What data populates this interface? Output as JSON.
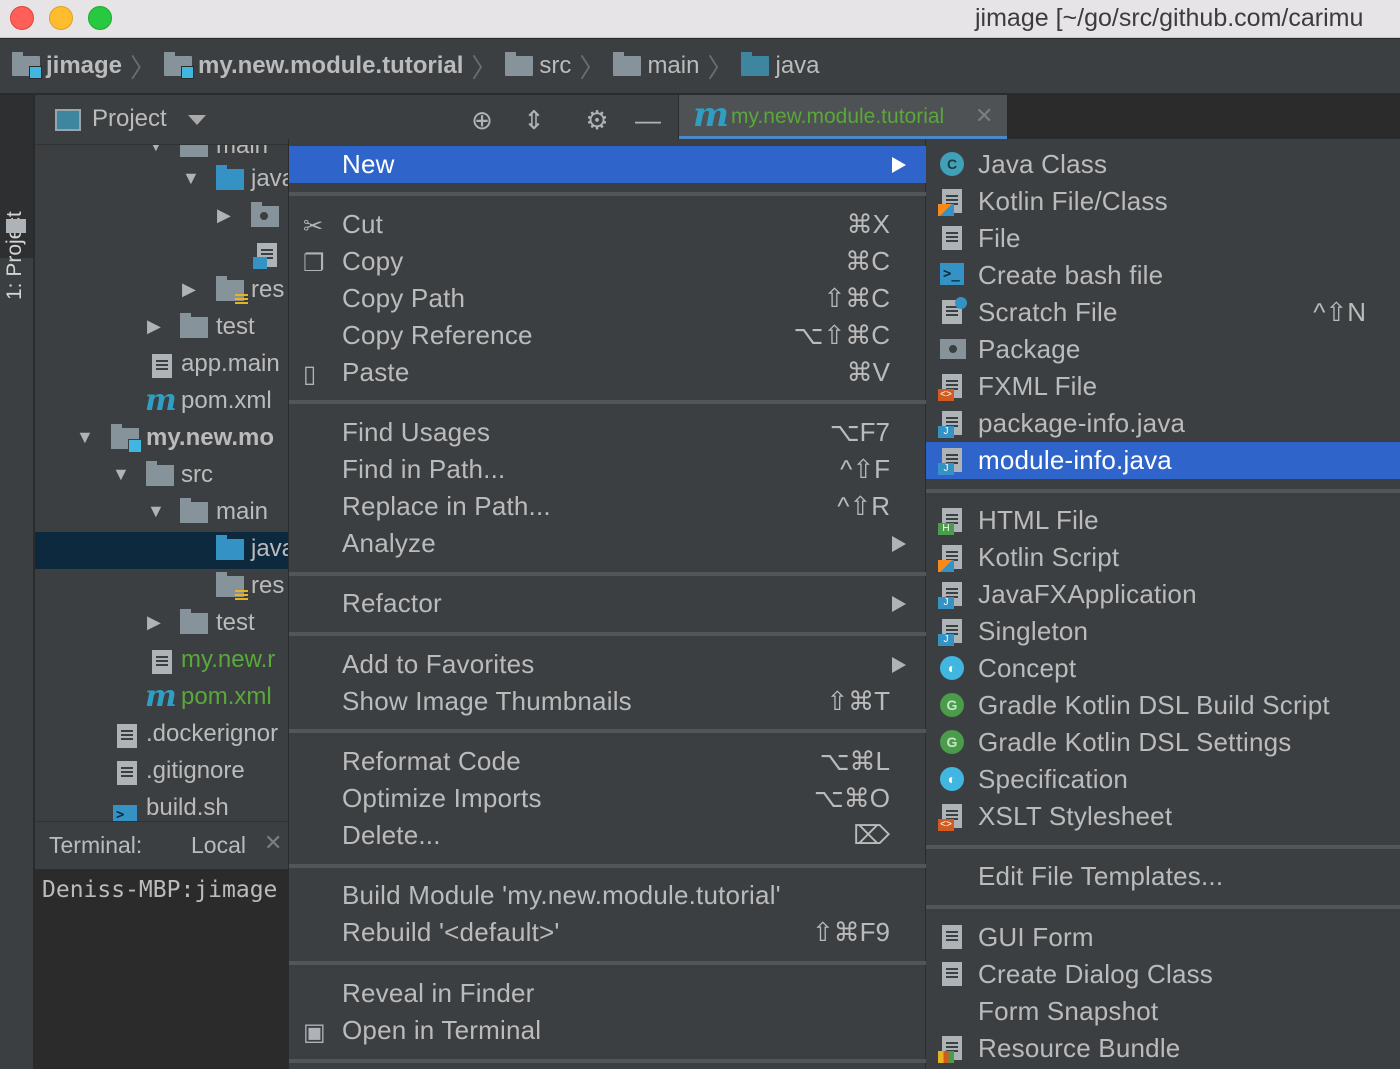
{
  "window": {
    "title": "jimage [~/go/src/github.com/carimu"
  },
  "breadcrumb": [
    "jimage",
    "my.new.module.tutorial",
    "src",
    "main",
    "java"
  ],
  "toolstrip": {
    "project_tab": "1: Project"
  },
  "project_panel": {
    "title": "Project"
  },
  "editor_tab": {
    "name": "my.new.module.tutorial"
  },
  "tree": {
    "rows": [
      {
        "label": "main"
      },
      {
        "label": "java"
      },
      {
        "label": ""
      },
      {
        "label": ""
      },
      {
        "label": "res"
      },
      {
        "label": "test"
      },
      {
        "label": "app.main"
      },
      {
        "label": "pom.xml"
      },
      {
        "label": "my.new.mo"
      },
      {
        "label": "src"
      },
      {
        "label": "main"
      },
      {
        "label": "java"
      },
      {
        "label": "res"
      },
      {
        "label": "test"
      },
      {
        "label": "my.new.r"
      },
      {
        "label": "pom.xml"
      },
      {
        "label": ".dockerignor"
      },
      {
        "label": ".gitignore"
      },
      {
        "label": "build.sh"
      }
    ]
  },
  "terminal": {
    "title": "Terminal:",
    "tab": "Local",
    "prompt": "Deniss-MBP:jimage"
  },
  "context_menu": {
    "new": "New",
    "cut": {
      "label": "Cut",
      "shortcut": "⌘X"
    },
    "copy": {
      "label": "Copy",
      "shortcut": "⌘C"
    },
    "copy_path": {
      "label": "Copy Path",
      "shortcut": "⇧⌘C"
    },
    "copy_reference": {
      "label": "Copy Reference",
      "shortcut": "⌥⇧⌘C"
    },
    "paste": {
      "label": "Paste",
      "shortcut": "⌘V"
    },
    "find_usages": {
      "label": "Find Usages",
      "shortcut": "⌥F7"
    },
    "find_in_path": {
      "label": "Find in Path...",
      "shortcut": "^⇧F"
    },
    "replace_in_path": {
      "label": "Replace in Path...",
      "shortcut": "^⇧R"
    },
    "analyze": {
      "label": "Analyze"
    },
    "refactor": {
      "label": "Refactor"
    },
    "add_to_favorites": {
      "label": "Add to Favorites"
    },
    "show_thumbnails": {
      "label": "Show Image Thumbnails",
      "shortcut": "⇧⌘T"
    },
    "reformat": {
      "label": "Reformat Code",
      "shortcut": "⌥⌘L"
    },
    "optimize": {
      "label": "Optimize Imports",
      "shortcut": "⌥⌘O"
    },
    "delete": {
      "label": "Delete...",
      "shortcut": "⌦"
    },
    "build_module": {
      "label": "Build Module 'my.new.module.tutorial'"
    },
    "rebuild": {
      "label": "Rebuild '<default>'",
      "shortcut": "⇧⌘F9"
    },
    "reveal": {
      "label": "Reveal in Finder"
    },
    "open_terminal": {
      "label": "Open in Terminal"
    }
  },
  "new_submenu": {
    "java_class": "Java Class",
    "kotlin_file": "Kotlin File/Class",
    "file": "File",
    "bash": "Create bash file",
    "scratch": {
      "label": "Scratch File",
      "shortcut": "^⇧N"
    },
    "package": "Package",
    "fxml": "FXML File",
    "package_info": "package-info.java",
    "module_info": "module-info.java",
    "html": "HTML File",
    "kotlin_script": "Kotlin Script",
    "javafx": "JavaFXApplication",
    "singleton": "Singleton",
    "concept": "Concept",
    "gradle_build": "Gradle Kotlin DSL Build Script",
    "gradle_settings": "Gradle Kotlin DSL Settings",
    "specification": "Specification",
    "xslt": "XSLT Stylesheet",
    "edit_templates": "Edit File Templates...",
    "gui_form": "GUI Form",
    "dialog_class": "Create Dialog Class",
    "form_snapshot": "Form Snapshot",
    "resource_bundle": "Resource Bundle"
  },
  "colors": {
    "highlight": "#2f65ca",
    "menu_bg": "#3c3f41",
    "editor_bg": "#2b2b2b",
    "module_green": "#5aa73a",
    "folder_blue": "#3592c4"
  }
}
